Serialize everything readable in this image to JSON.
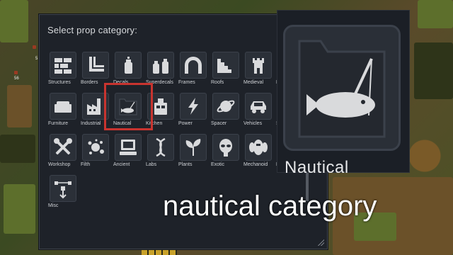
{
  "dialog": {
    "title": "Select prop category:"
  },
  "categories": [
    {
      "label": "Structures",
      "icon": "brick-wall-icon"
    },
    {
      "label": "Borders",
      "icon": "corner-border-icon"
    },
    {
      "label": "Decals",
      "icon": "spray-can-icon"
    },
    {
      "label": "Superdecals",
      "icon": "double-spray-can-icon"
    },
    {
      "label": "Frames",
      "icon": "arch-icon"
    },
    {
      "label": "Roofs",
      "icon": "stairs-icon"
    },
    {
      "label": "Medieval",
      "icon": "castle-tower-icon"
    },
    {
      "label": "Fa",
      "icon": "partial-icon"
    },
    {
      "label": "Furniture",
      "icon": "sofa-icon"
    },
    {
      "label": "Industrial",
      "icon": "factory-icon"
    },
    {
      "label": "Nautical",
      "icon": "fish-folder-icon"
    },
    {
      "label": "Kitchen",
      "icon": "kitchen-icon"
    },
    {
      "label": "Power",
      "icon": "lightning-icon"
    },
    {
      "label": "Spacer",
      "icon": "planet-icon"
    },
    {
      "label": "Vehicles",
      "icon": "car-icon"
    },
    {
      "label": "Sp",
      "icon": "partial-icon"
    },
    {
      "label": "Workshop",
      "icon": "tools-icon"
    },
    {
      "label": "Filth",
      "icon": "splatter-icon"
    },
    {
      "label": "Ancient",
      "icon": "terminal-icon"
    },
    {
      "label": "Labs",
      "icon": "dna-icon"
    },
    {
      "label": "Plants",
      "icon": "plant-icon"
    },
    {
      "label": "Exotic",
      "icon": "alien-icon"
    },
    {
      "label": "Mechanoid",
      "icon": "mechanoid-icon"
    },
    {
      "label": "Ef",
      "icon": "partial-icon"
    },
    {
      "label": "Misc",
      "icon": "bezier-pen-icon"
    }
  ],
  "selected_category": "Nautical",
  "preview": {
    "label": "Nautical",
    "icon": "fish-folder-icon"
  },
  "caption": "nautical category",
  "colors": {
    "highlight": "#c8342f",
    "panel": "#1e2229",
    "icon_fill": "#d9dadc"
  }
}
